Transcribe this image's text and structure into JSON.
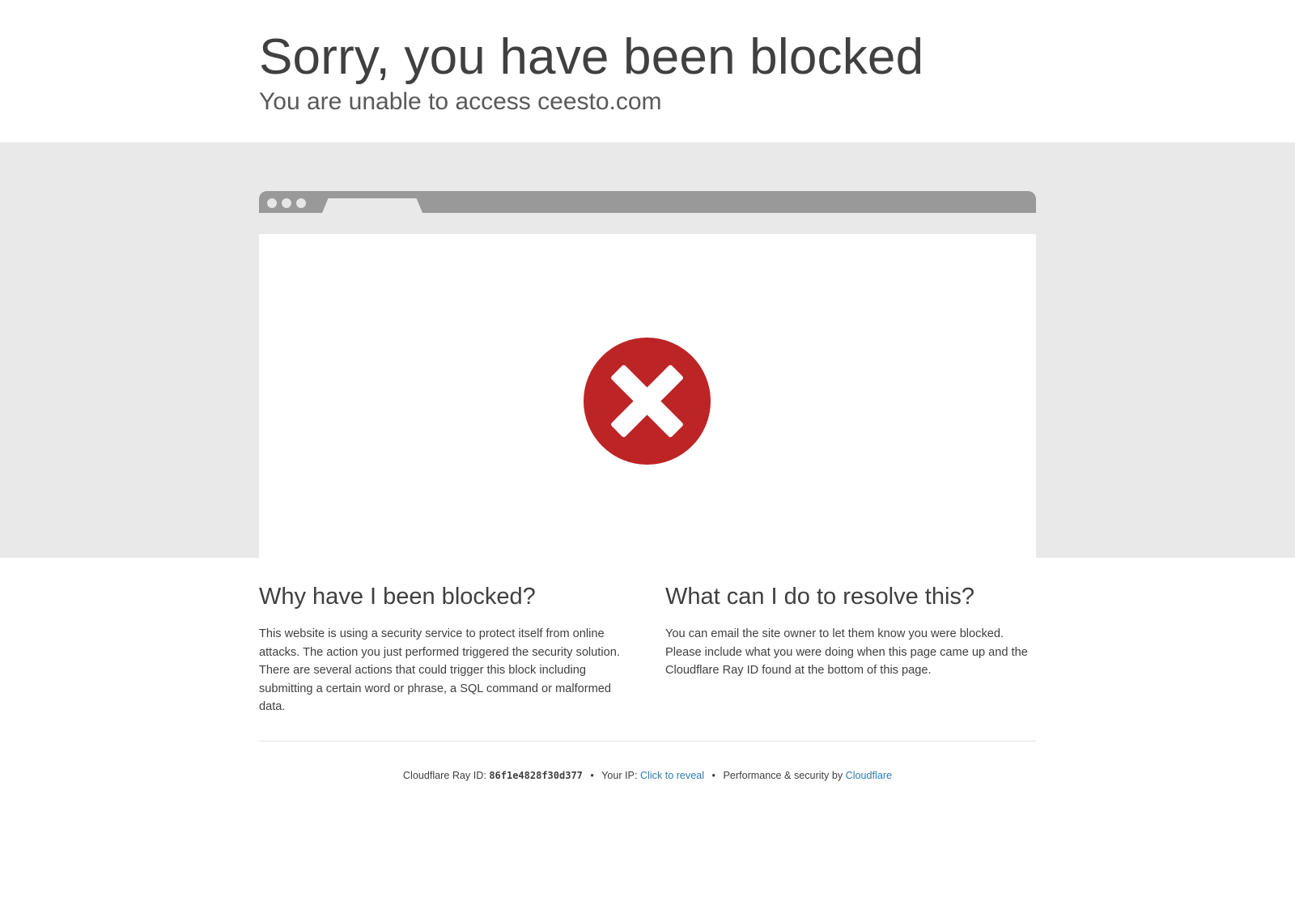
{
  "header": {
    "title": "Sorry, you have been blocked",
    "subtitle": "You are unable to access ceesto.com"
  },
  "illustration": {
    "icon": "block-x-icon",
    "icon_color": "#bd2426"
  },
  "why": {
    "heading": "Why have I been blocked?",
    "body": "This website is using a security service to protect itself from online attacks. The action you just performed triggered the security solution. There are several actions that could trigger this block including submitting a certain word or phrase, a SQL command or malformed data."
  },
  "resolve": {
    "heading": "What can I do to resolve this?",
    "body": "You can email the site owner to let them know you were blocked. Please include what you were doing when this page came up and the Cloudflare Ray ID found at the bottom of this page."
  },
  "footer": {
    "ray_label": "Cloudflare Ray ID:",
    "ray_id": "86f1e4828f30d377",
    "separator": "•",
    "ip_label": "Your IP:",
    "ip_link": "Click to reveal",
    "perf_label": "Performance & security by",
    "perf_link": "Cloudflare",
    "link_color": "#2c7cb0"
  }
}
